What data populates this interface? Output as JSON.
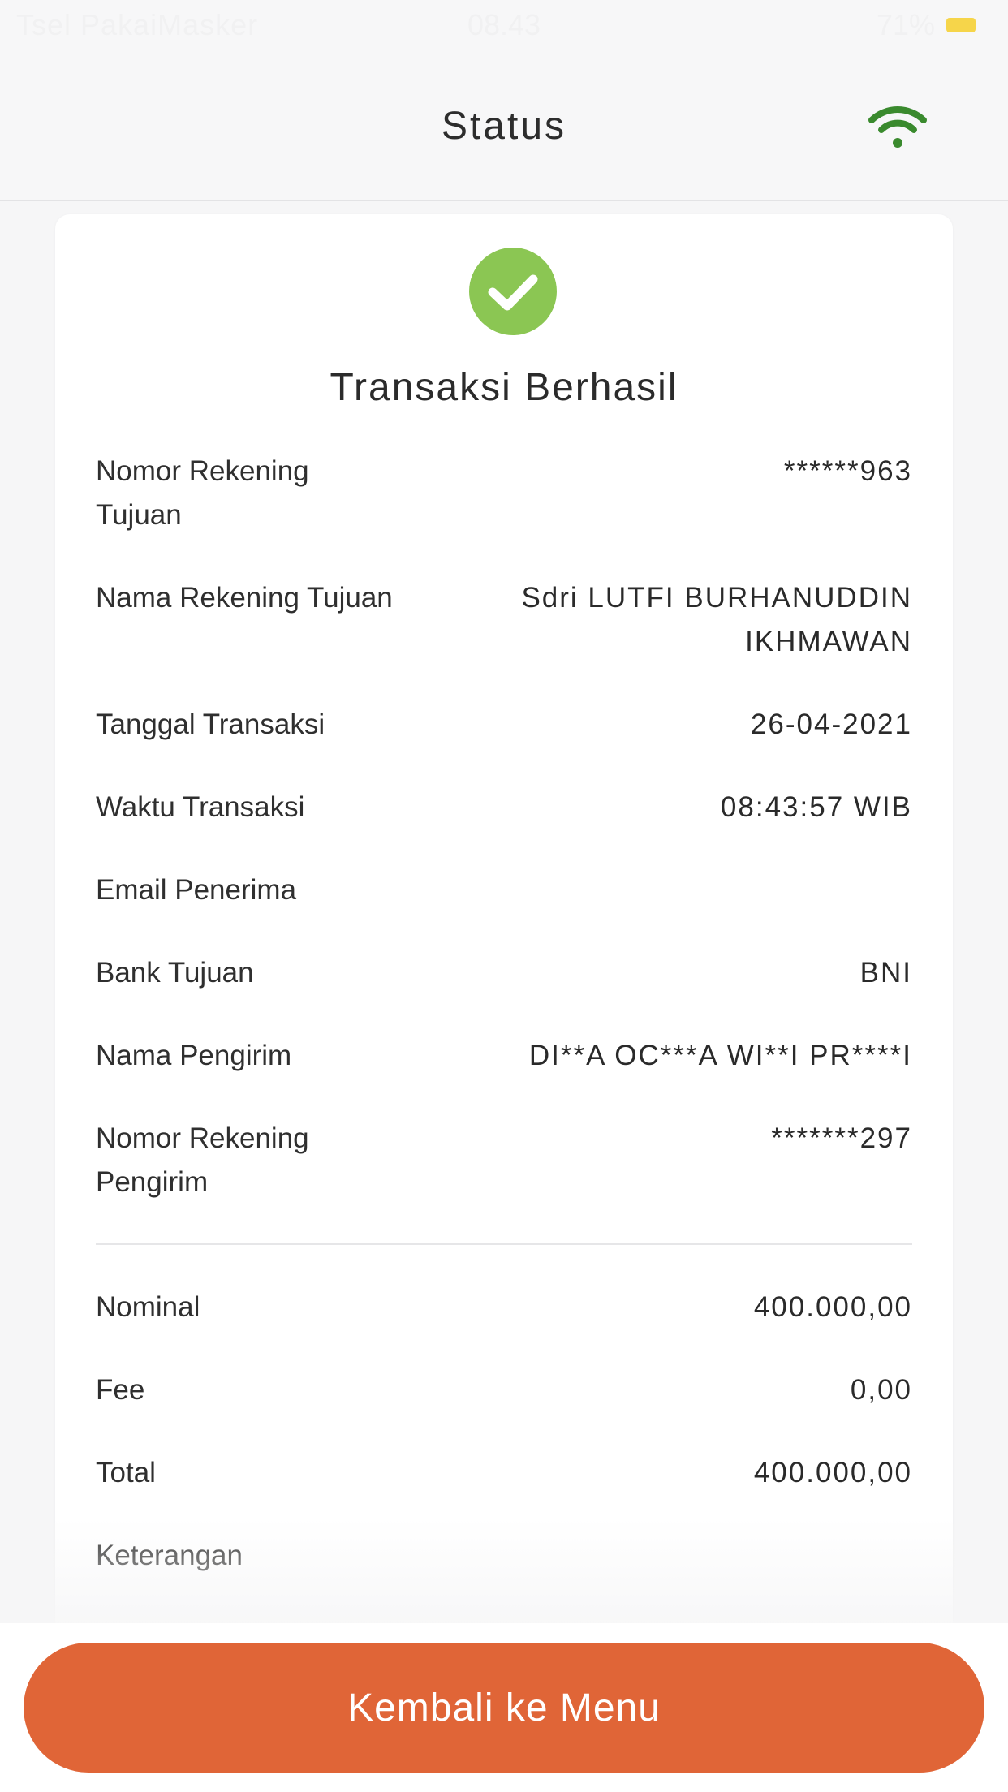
{
  "status_bar": {
    "left": "Tsel PakaiMasker",
    "time": "08.43",
    "battery": "71%"
  },
  "header": {
    "title": "Status",
    "wifi_icon": "wifi-icon",
    "wifi_color": "#3a8a2e"
  },
  "result": {
    "icon": "check-circle-icon",
    "icon_color": "#8bc653",
    "title": "Transaksi Berhasil"
  },
  "details": [
    {
      "label": "Nomor Rekening\nTujuan",
      "value": "******963"
    },
    {
      "label": "Nama Rekening Tujuan",
      "value": "Sdri LUTFI BURHANUDDIN\nIKHMAWAN"
    },
    {
      "label": "Tanggal Transaksi",
      "value": "26-04-2021"
    },
    {
      "label": "Waktu Transaksi",
      "value": "08:43:57 WIB"
    },
    {
      "label": "Email Penerima",
      "value": ""
    },
    {
      "label": "Bank Tujuan",
      "value": "BNI"
    },
    {
      "label": "Nama Pengirim",
      "value": "DI**A OC***A WI**I PR****I"
    },
    {
      "label": "Nomor Rekening\nPengirim",
      "value": "*******297"
    }
  ],
  "summary": [
    {
      "label": "Nominal",
      "value": "400.000,00"
    },
    {
      "label": "Fee",
      "value": "0,00"
    },
    {
      "label": "Total",
      "value": "400.000,00"
    },
    {
      "label": "Keterangan",
      "value": ""
    }
  ],
  "footer": {
    "button_label": "Kembali ke Menu",
    "button_color": "#e06537"
  }
}
